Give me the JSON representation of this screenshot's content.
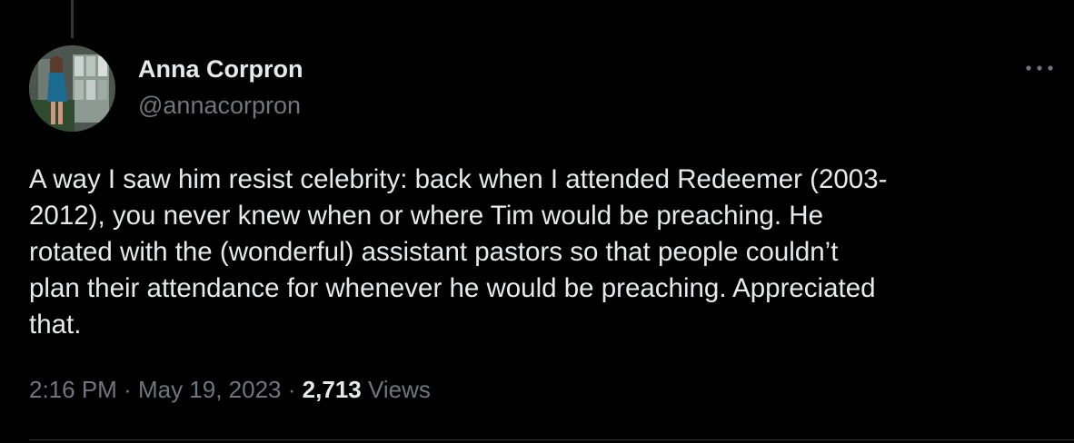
{
  "colors": {
    "background": "#000000",
    "primary_text": "#e7e9ea",
    "secondary_text": "#71767b",
    "divider": "#2f3336"
  },
  "author": {
    "name": "Anna Corpron",
    "handle": "@annacorpron",
    "avatar_icon": "profile-photo"
  },
  "more_icon": "ellipsis-icon",
  "tweet": {
    "text": "A way I saw him resist celebrity: back when I attended Redeemer (2003-\n2012), you never knew when or where Tim would be preaching. He\nrotated with the (wonderful) assistant pastors so that people couldn’t\nplan their attendance for whenever he would be preaching. Appreciated\nthat."
  },
  "meta": {
    "time": "2:16 PM",
    "separator": "·",
    "date": "May 19, 2023",
    "views_count": "2,713",
    "views_label": "Views"
  }
}
